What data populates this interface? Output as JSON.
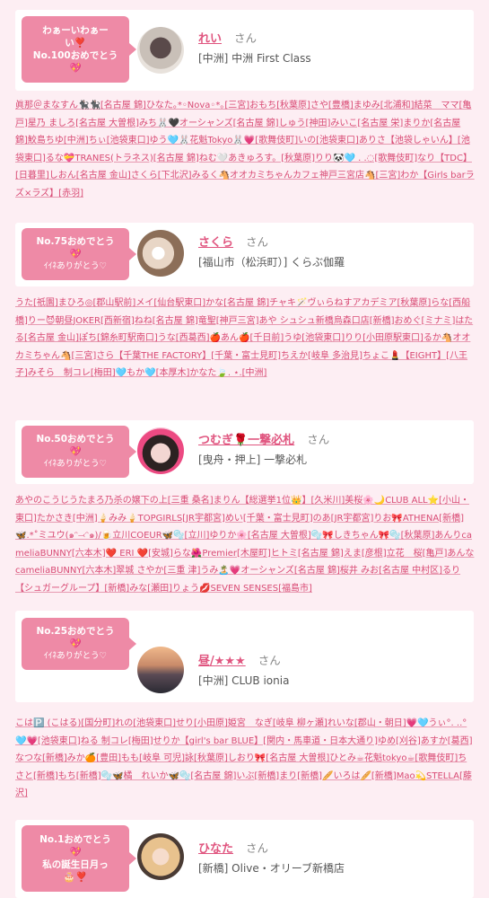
{
  "cards": [
    {
      "badge": [
        "わぁーいわぁー",
        "い❣️",
        "No.100おめでとう",
        "💖"
      ],
      "name": "れい",
      "san": "さん",
      "shop": "[中洲] 中洲 First Class"
    },
    {
      "badge": [
        "No.75おめでとう",
        "💖",
        "ｲｲﾈありがとう♡"
      ],
      "name": "さくら",
      "san": "さん",
      "shop": "[福山市（松浜町）] くらぶ伽羅"
    },
    {
      "badge": [
        "No.50おめでとう",
        "💖",
        "ｲｲﾈありがとう♡"
      ],
      "name": "つむぎ🌹一撃必札",
      "san": "さん",
      "shop": "[曳舟・押上] 一撃必札"
    },
    {
      "badge": [
        "No.25おめでとう",
        "💖",
        "ｲｲﾈありがとう♡"
      ],
      "name": "昼/★★★",
      "san": "さん",
      "shop": "[中洲] CLUB ionia"
    },
    {
      "badge": [
        "No.1おめでとう",
        "💖",
        "私の誕生日月っ",
        "🎂❣️"
      ],
      "name": "ひなた",
      "san": "さん",
      "shop": "[新橋] Olive・オリーブ新橋店"
    }
  ],
  "lists": [
    "眞那＠まなすん🐈‍⬛🐈‍⬛[名古屋 錦]ひなた｡*◦Nova◦*｡[三宮]おもち[秋葉原]さや[豊橋]まゆみ[北浦和]結菜　ママ[亀戸]星乃 ましろ[名古屋 大曽根]みち🐰🖤オーシャンズ[名古屋 錦]しゅう[神田]みいこ[名古屋 栄]まりか[名古屋 錦]鮫島ちゆ[中洲]ちぃ[池袋東口]ゆう🩵🐰花魁Tokyo🐰💗[歌舞伎町]いの[池袋東口]ありさ【池袋しゃいん】[池袋東口]るな💝TRANES(トラネス)[名古屋 錦]ねむ🤍あきゅろす。[秋葉原]りり🐼🩵 . .◌[歌舞伎町]なり【TDC】[日暮里]しおん[名古屋 金山]さくら[下北沢]みるく🐴オオカミちゃんカフェ神戸三宮店🐴[三宮]わか【Girls barラズ×ラズ】[赤羽]",
    "うた[祇園]まひろ◎[郡山駅前]メイ[仙台駅東口]かな[名古屋 錦]チャキ🪄ヴぃらねすアカデミア[秋葉原]らな[西船橋]りー😈朝昼JOKER[西新宿]ねね[名古屋 錦]竜聖[神戸三宮]あや シュシュ新橋烏森口店[新橋]おめぐ[ミナミ]はたる[名古屋 金山]ぽち[錦糸町駅南口]うな[西葛西]🍎あん🍎[千日前]うゆ[池袋東口]りり[小田原駅東口]るか🐴オオカミちゃん🐴[三宮]さら【千葉THE FACTORY】[千葉・富士見町]ちえか[岐阜 多治見]ちょこ💄【EIGHT】[八王子]みそら　制コレ[梅田]🩵もか🩵[本厚木]かなた🍃. ⋆.[中洲]",
    "あやのこうじうたまろ乃杀の嬢下の上[三重 桑名]まりん【総選挙1位👑】[久米川]美桜🌸🌙CLUB ALL⭐[小山・東口]たかさき[中洲]🍦みみ🍦TOPGIRLS[JR宇都宮]めい[千葉・富士見町]のあ[JR宇都宮]りお🎀ATHENA[新橋]🦋.*˚ミユウ(๑ᵔ⤙ᵔ๑)/🍺立川COEUR🦋🫧[立川]ゆりか🌸[名古屋 大曽根]🫧🎀しきちゃん🎀🫧[秋葉原]あんりcameliaBUNNY[六本木]❤️ ERI ❤️[安城]らな🌺Premier[木屋町]ヒトミ[名古屋 錦]えま[彦根]立花　桜[亀戸]あんなcameliaBUNNY[六本木]翠城 さやか[三重 津]うみ🏝️💗オーシャンズ[名古屋 錦]桜井 みお[名古屋 中村区]るり【シュガーグループ】[新橋]みな[瀬田]りょう💋SEVEN SENSES[福島市]",
    "こは🅿️ (こはる)[国分町]れの[池袋東口]せり[小田原]姫宮　なぎ[岐阜 柳ヶ瀬]れいな[郡山・朝日]💗🩵うぃ°. ..°🩵💗[池袋東口]ねる 制コレ[梅田]せりか【girl's bar BLUE】[関内・馬車道・日本大通り]ゆめ[刈谷]あすか[葛西]なつな[新橋]みか🍊[豊田]もも[岐阜 可児]詠[秋葉原]しおり🎀[名古屋 大曽根]ひとみ☕花魁tokyo☕[歌舞伎町]ちさと[新橋]もち[新橋]🫧🦋橘　れいか🦋🫧[名古屋 錦]いぶ[新橋]まり[新橋]🥖いろは🥖[新橋]Mao💫STELLA[藤沢]"
  ]
}
